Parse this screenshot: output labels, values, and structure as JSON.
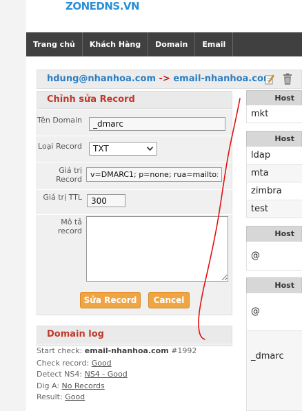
{
  "logo": "ZONEDNS.VN",
  "nav": [
    "Trang chủ",
    "Khách Hàng",
    "Domain",
    "Email"
  ],
  "email_bar": {
    "from": "hdung@nhanhoa.com",
    "arrow": "->",
    "to": "email-nhanhoa.com"
  },
  "edit_record": {
    "title": "Chỉnh sửa Record",
    "domain_label": "Tên Domain",
    "domain_value": "_dmarc",
    "type_label": "Loại Record",
    "type_value": "TXT",
    "value_label": "Giá trị Record",
    "value_value": "v=DMARC1; p=none; rua=mailto:",
    "ttl_label": "Giá trị TTL",
    "ttl_value": "300",
    "desc_label": "Mô tả record",
    "desc_value": "",
    "save_button": "Sửa Record",
    "cancel_button": "Cancel"
  },
  "domain_log": {
    "title": "Domain log",
    "start_label": "Start check:",
    "start_domain": "email-nhanhoa.com",
    "start_id": "#1992",
    "check_label": "Check record:",
    "check_value": "Good",
    "ns4_label": "Detect NS4:",
    "ns4_value": "NS4 - Good",
    "dig_label": "Dig A:",
    "dig_value": "No Records",
    "result_label": "Result:",
    "result_value": "Good"
  },
  "hosts_table": {
    "header": "Host",
    "groups": [
      [
        "mkt"
      ],
      [
        "ldap",
        "mta",
        "zimbra",
        "test"
      ],
      [
        "@"
      ],
      [
        "@",
        "_dmarc"
      ]
    ]
  }
}
